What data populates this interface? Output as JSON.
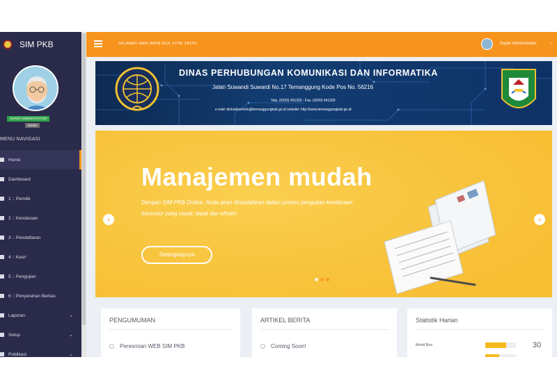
{
  "sidebar": {
    "brand": "SIM PKB",
    "role_badge": "SUPER ADMINISTRATOR",
    "role_badge2": "ADMIN",
    "menu_header": "MENU NAVIGASI",
    "items": [
      {
        "label": "Home",
        "icon": "home-icon",
        "active": true
      },
      {
        "label": "Dashboard",
        "icon": "dashboard-icon"
      },
      {
        "label": "1 :: Pemilik",
        "icon": "user-icon"
      },
      {
        "label": "2 :: Kendaraan",
        "icon": "car-icon"
      },
      {
        "label": "3 :: Pendaftaran",
        "icon": "sign-in-icon"
      },
      {
        "label": "4 :: Kasir",
        "icon": "cash-icon"
      },
      {
        "label": "5 :: Pengujian",
        "icon": "test-icon"
      },
      {
        "label": "6 :: Penyerahan Berkas",
        "icon": "document-icon"
      },
      {
        "label": "Laporan",
        "icon": "report-icon",
        "caret": true
      },
      {
        "label": "Setup",
        "icon": "settings-icon",
        "caret": true
      },
      {
        "label": "Publikasi",
        "icon": "publish-icon",
        "caret": true
      }
    ]
  },
  "topbar": {
    "greeting": "SELAMAT HARI RAYA IDUL FITRI 1437H",
    "user_name": "Super Administrator"
  },
  "banner": {
    "title": "DINAS PERHUBUNGAN KOMUNIKASI DAN INFORMATIKA",
    "address": "Jalan Suwandi Suwardi No.17 Temanggung Kode Pos No. 56216",
    "phone": "Telp. (0293) 491320 - Fax. (0293) 491329",
    "contact": "e-mail: dishubkominfo@temanggungkab.go.id  website: http://www.temanggungkab.go.id"
  },
  "carousel": {
    "title": "Manajemen mudah",
    "text": "Dengan SIM PKB Online, Anda akan dimudahkan dalam proses pengujian kendaraan bermotor yang cepat, tepat dan efisien.",
    "button": "Selengkapnya",
    "prev": "‹",
    "next": "›",
    "slide_count": 3,
    "active_slide": 1
  },
  "boxes": {
    "announcement": {
      "title": "PENGUMUMAN",
      "item": "Peresmian WEB SIM PKB"
    },
    "news": {
      "title": "ARTIKEL BERITA",
      "item": "Coming Soon!"
    },
    "stats": {
      "title": "Statistik Harian",
      "label": "Mobil Bus",
      "value": "30",
      "fill": 0.68,
      "fill2": 0.45
    }
  },
  "colors": {
    "accent": "#f7941d",
    "sidebar": "#2a2a4a",
    "carousel": "#f9c940"
  }
}
